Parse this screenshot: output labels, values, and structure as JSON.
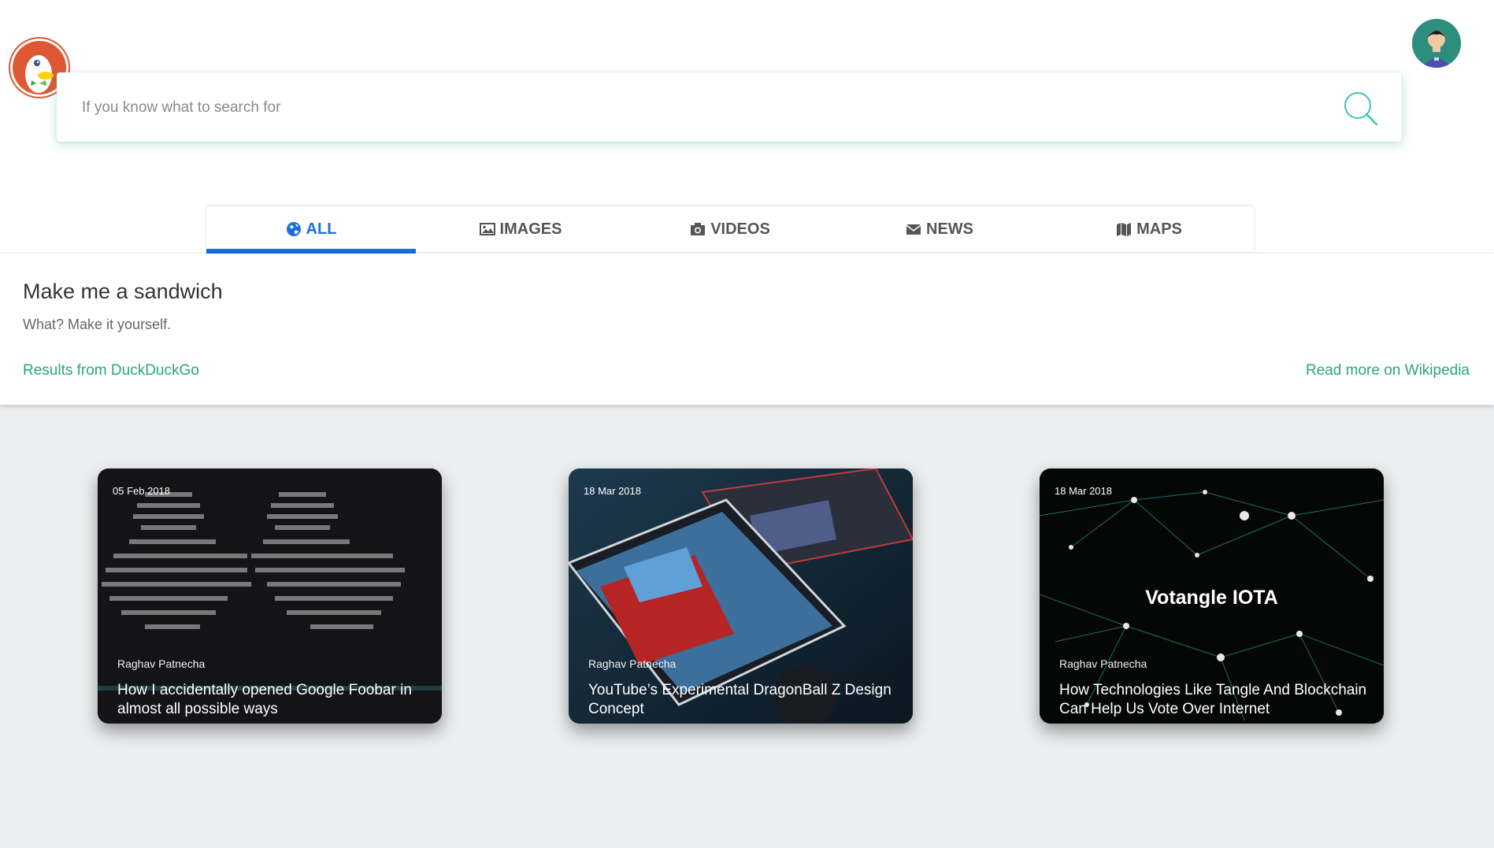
{
  "search": {
    "placeholder": "If you know what to search for",
    "value": ""
  },
  "tabs": [
    {
      "label": "ALL",
      "icon": "globe-icon",
      "active": true
    },
    {
      "label": "IMAGES",
      "icon": "image-icon",
      "active": false
    },
    {
      "label": "VIDEOS",
      "icon": "camera-icon",
      "active": false
    },
    {
      "label": "NEWS",
      "icon": "envelope-icon",
      "active": false
    },
    {
      "label": "MAPS",
      "icon": "map-icon",
      "active": false
    }
  ],
  "instant_answer": {
    "title": "Make me a sandwich",
    "description": "What? Make it yourself.",
    "source_link": "Results from DuckDuckGo",
    "more_link": "Read more on Wikipedia"
  },
  "articles": [
    {
      "date": "05 Feb 2018",
      "author": "Raghav Patnecha",
      "title": "How I accidentally opened Google Foobar in almost all possible ways"
    },
    {
      "date": "18 Mar 2018",
      "author": "Raghav Patnecha",
      "title": "YouTube’s Experimental DragonBall Z Design Concept"
    },
    {
      "date": "18 Mar 2018",
      "author": "Raghav Patnecha",
      "title": "How Technologies Like Tangle And Blockchain Can Help Us Vote Over Internet",
      "image_text": "Votangle IOTA"
    }
  ],
  "colors": {
    "accent_blue": "#1a6fd9",
    "link_green": "#2aa57f",
    "search_glow": "#28aa96",
    "page_background": "#eceff0"
  }
}
